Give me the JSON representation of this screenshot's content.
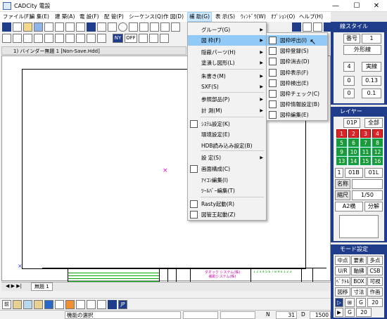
{
  "titlebar": {
    "title": "CADCity 電設",
    "minimize": "—",
    "maximize": "☐",
    "close": "✕"
  },
  "menubar": {
    "items": [
      "ファイル(F)",
      "編 集(E)",
      "建 築(A)",
      "電 設(F)",
      "配 管(P)",
      "シーケンス(Q)",
      "作 図(D)",
      "補 助(G)",
      "表 示(S)",
      "ｳｨﾝﾄﾞｳ(W)",
      "ｵﾌﾟｼｮﾝ(O)",
      "ヘルプ(H)"
    ]
  },
  "toolbar2": {
    "ny": "NY",
    "off": "OFF"
  },
  "document_tab": {
    "title": "1) バインダー無題 1 [Non-Save.Hdd]"
  },
  "titleblock": {
    "company": "ダオック システム(株)",
    "system": "補助システム(株)",
    "code": "1 2 3 4 5 6 7 8 9 0 1 2 3"
  },
  "menu_hojo": {
    "items": [
      {
        "label": "グループ(G)",
        "arrow": true
      },
      {
        "label": "図 枠(F)",
        "arrow": true,
        "highlighted": true
      },
      {
        "label": "隠蔽パーツ(H)",
        "arrow": true
      },
      {
        "label": "塗潰し図形(L)",
        "arrow": true
      },
      {
        "label": "朱書き(M)",
        "arrow": true
      },
      {
        "label": "SXF(S)",
        "arrow": true
      },
      {
        "label": "参照部品(P)",
        "arrow": true
      },
      {
        "label": "計 測(M)",
        "arrow": true
      },
      {
        "label": "ｼｽﾃﾑ設定(K)",
        "arrow": false,
        "icon": true
      },
      {
        "label": "環境設定(E)",
        "arrow": false
      },
      {
        "label": "HDB読み込み設定(B)",
        "arrow": false
      },
      {
        "label": "設 定(S)",
        "arrow": true
      },
      {
        "label": "画面構成(C)",
        "arrow": false,
        "icon": true
      },
      {
        "label": "ｱｲｺﾝ編集(I)",
        "arrow": false
      },
      {
        "label": "ﾂｰﾙﾊﾞｰ編集(T)",
        "arrow": false
      },
      {
        "label": "Rasty起動(R)",
        "arrow": false,
        "icon": true
      },
      {
        "label": "図管王起動(Z)",
        "arrow": false,
        "icon": true
      }
    ]
  },
  "menu_zuwaku": {
    "items": [
      {
        "label": "図枠呼出(I)",
        "highlighted": true
      },
      {
        "label": "図枠登録(S)"
      },
      {
        "label": "図枠消去(D)"
      },
      {
        "label": "図枠表示(F)"
      },
      {
        "label": "図枠検出(E)"
      },
      {
        "label": "図枠チェック(C)"
      },
      {
        "label": "図枠情報設定(B)"
      },
      {
        "label": "図枠編集(E)"
      }
    ]
  },
  "line_style_panel": {
    "title": "線スタイル",
    "number_label": "番号",
    "number_value": "1",
    "type_value": "外形線",
    "color_value": "4",
    "line_value": "実線",
    "width1": "0",
    "width1_val": "0.13",
    "width2": "0",
    "width2_val": "0.1"
  },
  "layer_panel": {
    "title": "レイヤー",
    "current": "01P",
    "all_label": "全部",
    "layers": [
      "1",
      "2",
      "3",
      "4",
      "5",
      "6",
      "7",
      "8",
      "9",
      "10",
      "11",
      "12",
      "13",
      "14",
      "15",
      "16"
    ],
    "r1": "1",
    "r2": "01B",
    "r3": "01L",
    "name_label": "名称",
    "scale_label": "縮尺",
    "scale_value": "1/50",
    "paper_value": "A2横",
    "split_label": "分解"
  },
  "mode_panel": {
    "title": "モード設定",
    "row1": [
      "中点",
      "要素",
      "多点"
    ],
    "row2": [
      "U/R",
      "軸拂",
      "CSB"
    ],
    "row3": [
      "ﾍﾞｸﾄﾙ",
      "BOX",
      "可視"
    ],
    "row4": [
      "図移",
      "寸法",
      "作画"
    ],
    "g1_label": "G",
    "g1_value": "20",
    "g2_label": "G",
    "g2_value": "20"
  },
  "sheet_tabs": {
    "tab": "無題 1"
  },
  "bottom_toolbar": {
    "first": "前",
    "jp": "JP"
  },
  "statusbar": {
    "message": "機能の選択",
    "n_label": "N",
    "n_value": "31",
    "d_label": "D",
    "d_value": "1500"
  },
  "colors": {
    "accent": "#1f3c8a",
    "highlight": "#91c9f7",
    "green": "#1c9a3a",
    "red": "#d9262b"
  }
}
